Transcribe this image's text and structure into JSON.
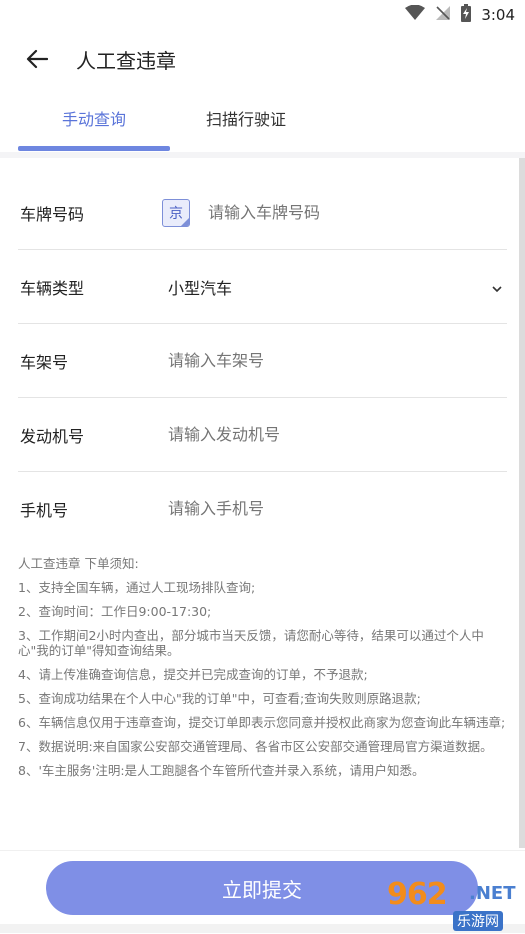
{
  "status_bar": {
    "time": "3:04",
    "icons": [
      "wifi-icon",
      "no-signal-icon",
      "battery-charging-icon"
    ]
  },
  "app_bar": {
    "back_icon": "arrow-left-icon",
    "title": "人工查违章"
  },
  "tabs": [
    {
      "label": "手动查询",
      "active": true
    },
    {
      "label": "扫描行驶证",
      "active": false
    }
  ],
  "colors": {
    "accent": "#5A74D9",
    "button": "#7F8FE6",
    "placeholder": "#BDBDBD"
  },
  "form": {
    "plate": {
      "label": "车牌号码",
      "prefix": "京",
      "placeholder": "请输入车牌号码"
    },
    "vehicle_type": {
      "label": "车辆类型",
      "value": "小型汽车",
      "icon": "chevron-down-icon"
    },
    "frame": {
      "label": "车架号",
      "placeholder": "请输入车架号"
    },
    "engine": {
      "label": "发动机号",
      "placeholder": "请输入发动机号"
    },
    "phone": {
      "label": "手机号",
      "placeholder": "请输入手机号"
    }
  },
  "notes": {
    "heading": "人工查违章 下单须知:",
    "items": [
      "1、支持全国车辆，通过人工现场排队查询;",
      "2、查询时间：工作日9:00-17:30;",
      "3、工作期间2小时内查出，部分城市当天反馈，请您耐心等待，结果可以通过个人中心\"我的订单\"得知查询结果。",
      "4、请上传准确查询信息，提交并已完成查询的订单，不予退款;",
      "5、查询成功结果在个人中心\"我的订单\"中，可查看;查询失败则原路退款;",
      "6、车辆信息仅用于违章查询，提交订单即表示您同意并授权此商家为您查询此车辆违章;",
      "7、数据说明:来自国家公安部交通管理局、各省市区公安部交通管理局官方渠道数据。",
      "8、'车主服务'注明:是人工跑腿各个车管所代查并录入系统，请用户知悉。"
    ]
  },
  "submit": {
    "label": "立即提交"
  },
  "watermark": {
    "main": "962",
    "net": ".NET",
    "sub": "乐游网"
  }
}
